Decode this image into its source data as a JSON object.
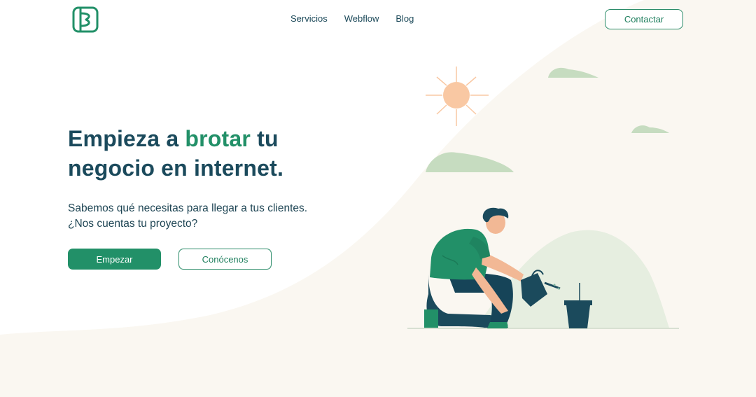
{
  "nav": {
    "links": [
      "Servicios",
      "Webflow",
      "Blog"
    ],
    "contact_label": "Contactar"
  },
  "hero": {
    "title_part1": "Empieza a ",
    "title_accent": "brotar",
    "title_part2": " tu",
    "title_line2": "negocio en internet.",
    "subtitle_line1": "Sabemos qué necesitas para llegar a tus clientes.",
    "subtitle_line2": "¿Nos cuentas tu proyecto?",
    "primary_button": "Empezar",
    "secondary_button": "Conócenos"
  },
  "colors": {
    "brand_green": "#229068",
    "heading_navy": "#1b4a5c",
    "background_cream": "#faf7f1",
    "cloud_green": "#c6dcc0",
    "sun_peach": "#f9c8a3"
  },
  "icons": [
    "logo-icon",
    "sun-icon",
    "cloud-icon",
    "plant-pot-icon",
    "watering-can-icon",
    "gardener-illustration"
  ]
}
